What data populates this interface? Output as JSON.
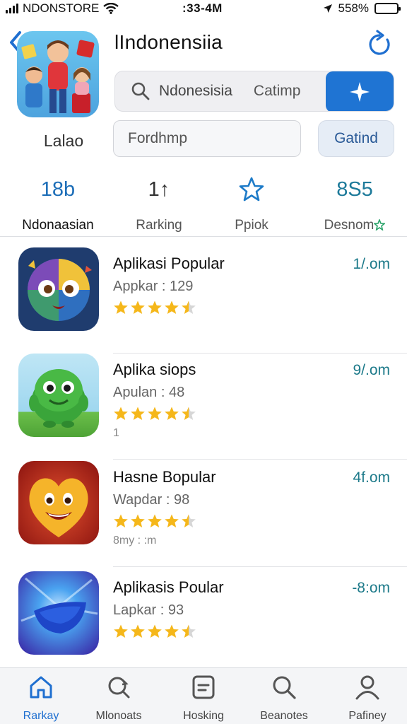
{
  "status_bar": {
    "carrier": "NDONSTORE",
    "time": ":33-4M",
    "battery": "558%"
  },
  "header": {
    "title": "lIndonensiia",
    "app_caption": "Lalao",
    "search": {
      "query": "Ndonesisia",
      "hint": "Catimp"
    },
    "secondary": {
      "field_value": "Fordhmp",
      "button_label": "Gatind"
    }
  },
  "stats": [
    {
      "value": "18b",
      "label": "Ndonaasian"
    },
    {
      "value": "1↑",
      "label": "Rarking"
    },
    {
      "value": "",
      "label": "Ppiok"
    },
    {
      "value": "8S5",
      "label": "Desnom"
    }
  ],
  "apps": [
    {
      "name": "Aplikasi Popular",
      "sub": "Appkar : 129",
      "rating": 4.5,
      "size": "1/.om",
      "extra": ""
    },
    {
      "name": "Aplika siops",
      "sub": "Apulan : 48",
      "rating": 4.5,
      "size": "9/.om",
      "extra": "1"
    },
    {
      "name": "Hasne Bopular",
      "sub": "Wapdar : 98",
      "rating": 4.5,
      "size": "4f.om",
      "extra": "8my : :m"
    },
    {
      "name": "Aplikasis Poular",
      "sub": "Lapkar : 93",
      "rating": 4.5,
      "size": "-8:om",
      "extra": ""
    }
  ],
  "tabs": [
    {
      "label": "Rarkay",
      "icon": "home-icon",
      "active": true
    },
    {
      "label": "Mlonoats",
      "icon": "refresh-search-icon",
      "active": false
    },
    {
      "label": "Hosking",
      "icon": "document-icon",
      "active": false
    },
    {
      "label": "Beanotes",
      "icon": "search-icon",
      "active": false
    },
    {
      "label": "Pafiney",
      "icon": "profile-icon",
      "active": false
    }
  ],
  "colors": {
    "accent": "#1f6fd0",
    "star": "#f5b71a",
    "size_text": "#1d7a8a"
  }
}
